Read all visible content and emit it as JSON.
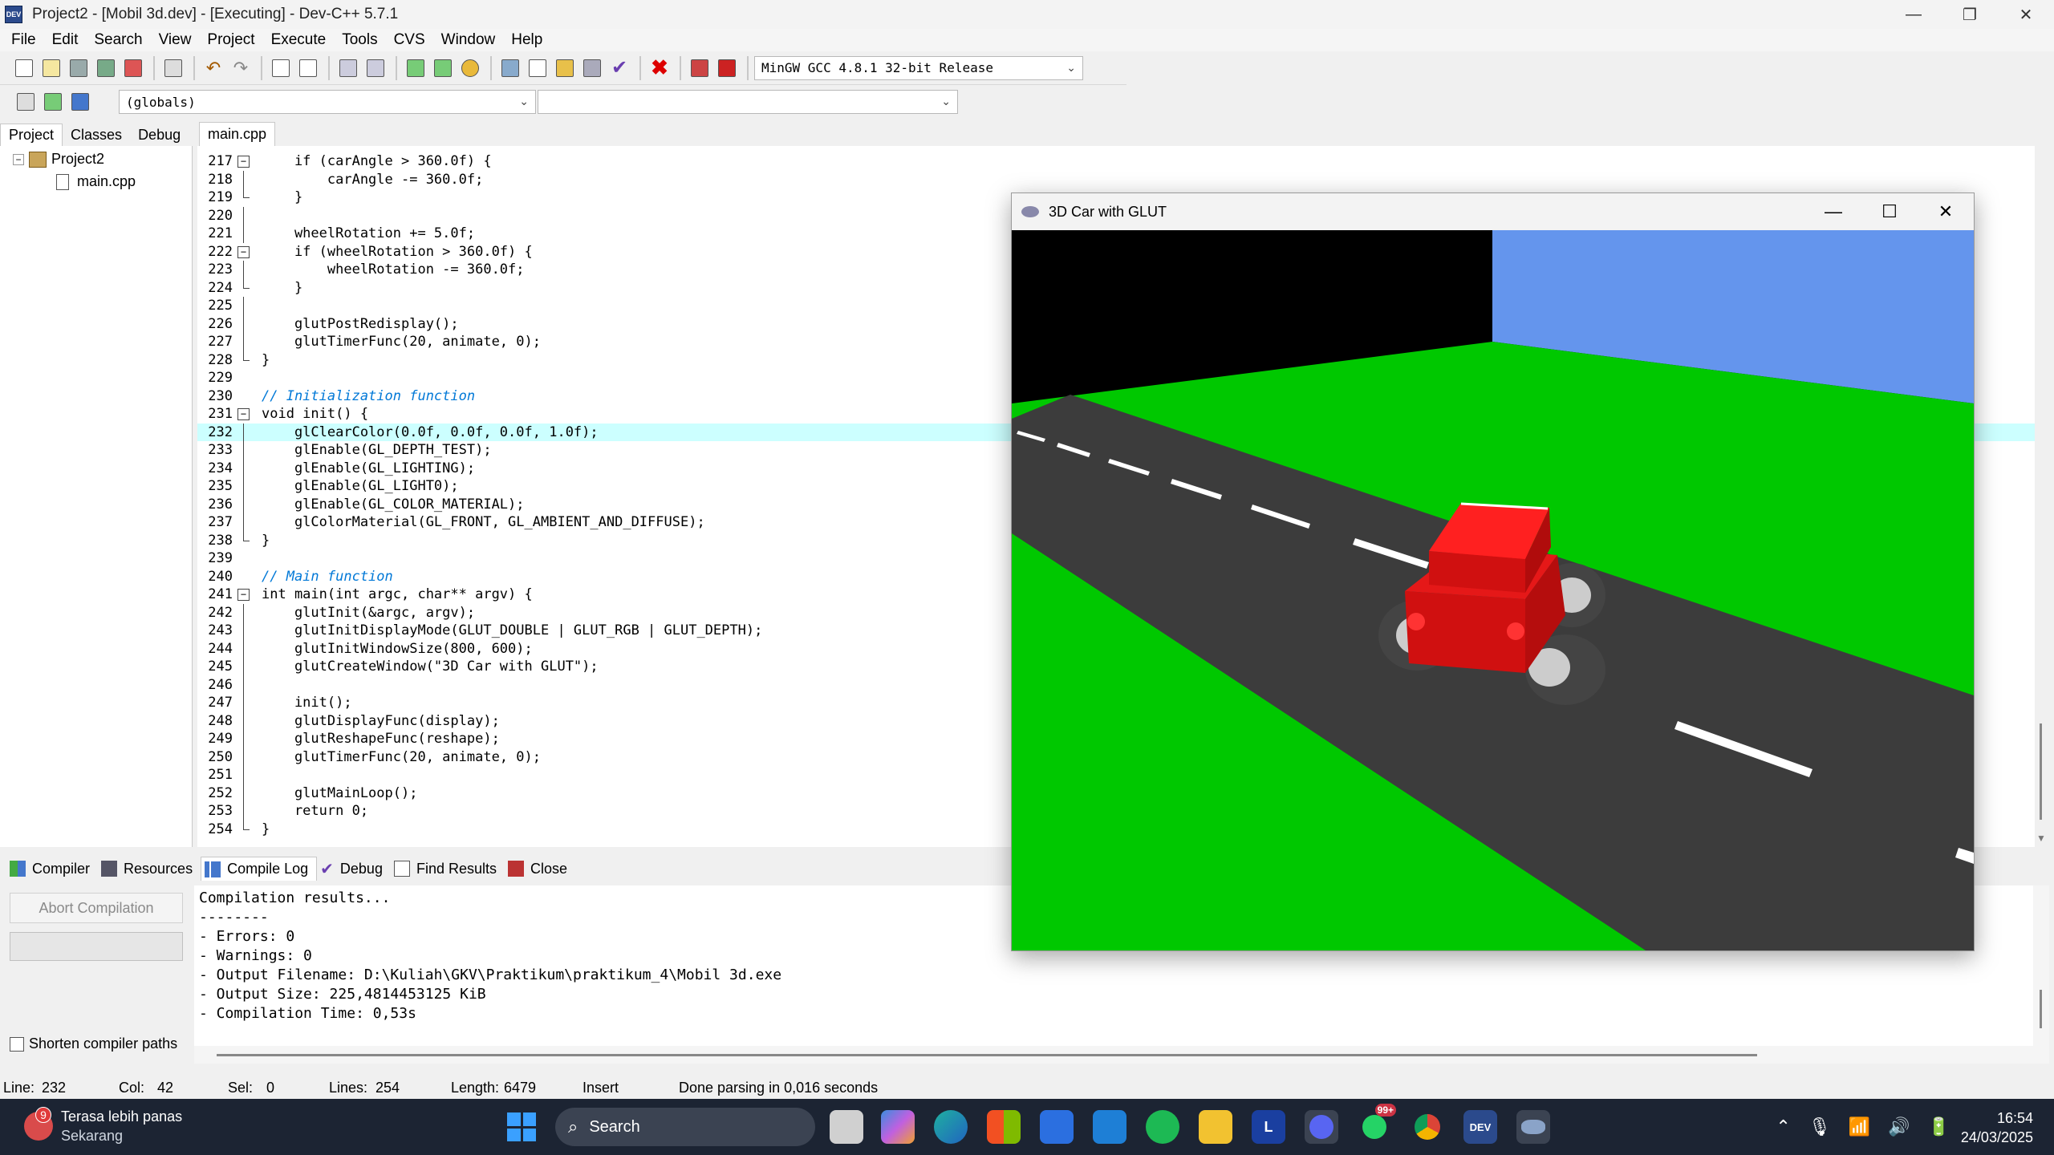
{
  "window": {
    "title": "Project2 - [Mobil 3d.dev] - [Executing] - Dev-C++ 5.7.1",
    "icon_text": "DEV"
  },
  "menu": [
    "File",
    "Edit",
    "Search",
    "View",
    "Project",
    "Execute",
    "Tools",
    "CVS",
    "Window",
    "Help"
  ],
  "toolbar": {
    "compiler_select": "MinGW GCC 4.8.1 32-bit Release",
    "scope_select": "(globals)",
    "symbol_select": ""
  },
  "left_panel": {
    "tabs": [
      "Project",
      "Classes",
      "Debug"
    ],
    "tree": {
      "project": "Project2",
      "expander": "−",
      "file": "main.cpp"
    }
  },
  "editor": {
    "tab": "main.cpp",
    "highlighted_line": 232,
    "lines": [
      {
        "n": "217",
        "code": "    if (carAngle > 360.0f) {"
      },
      {
        "n": "218",
        "code": "        carAngle -= 360.0f;"
      },
      {
        "n": "219",
        "code": "    }"
      },
      {
        "n": "220",
        "code": ""
      },
      {
        "n": "221",
        "code": "    wheelRotation += 5.0f;"
      },
      {
        "n": "222",
        "code": "    if (wheelRotation > 360.0f) {"
      },
      {
        "n": "223",
        "code": "        wheelRotation -= 360.0f;"
      },
      {
        "n": "224",
        "code": "    }"
      },
      {
        "n": "225",
        "code": ""
      },
      {
        "n": "226",
        "code": "    glutPostRedisplay();"
      },
      {
        "n": "227",
        "code": "    glutTimerFunc(20, animate, 0);"
      },
      {
        "n": "228",
        "code": "}"
      },
      {
        "n": "229",
        "code": ""
      },
      {
        "n": "230",
        "code": "// Initialization function"
      },
      {
        "n": "231",
        "code": "void init() {"
      },
      {
        "n": "232",
        "code": "    glClearColor(0.0f, 0.0f, 0.0f, 1.0f);"
      },
      {
        "n": "233",
        "code": "    glEnable(GL_DEPTH_TEST);"
      },
      {
        "n": "234",
        "code": "    glEnable(GL_LIGHTING);"
      },
      {
        "n": "235",
        "code": "    glEnable(GL_LIGHT0);"
      },
      {
        "n": "236",
        "code": "    glEnable(GL_COLOR_MATERIAL);"
      },
      {
        "n": "237",
        "code": "    glColorMaterial(GL_FRONT, GL_AMBIENT_AND_DIFFUSE);"
      },
      {
        "n": "238",
        "code": "}"
      },
      {
        "n": "239",
        "code": ""
      },
      {
        "n": "240",
        "code": "// Main function"
      },
      {
        "n": "241",
        "code": "int main(int argc, char** argv) {"
      },
      {
        "n": "242",
        "code": "    glutInit(&argc, argv);"
      },
      {
        "n": "243",
        "code": "    glutInitDisplayMode(GLUT_DOUBLE | GLUT_RGB | GLUT_DEPTH);"
      },
      {
        "n": "244",
        "code": "    glutInitWindowSize(800, 600);"
      },
      {
        "n": "245",
        "code": "    glutCreateWindow(\"3D Car with GLUT\");"
      },
      {
        "n": "246",
        "code": ""
      },
      {
        "n": "247",
        "code": "    init();"
      },
      {
        "n": "248",
        "code": "    glutDisplayFunc(display);"
      },
      {
        "n": "249",
        "code": "    glutReshapeFunc(reshape);"
      },
      {
        "n": "250",
        "code": "    glutTimerFunc(20, animate, 0);"
      },
      {
        "n": "251",
        "code": ""
      },
      {
        "n": "252",
        "code": "    glutMainLoop();"
      },
      {
        "n": "253",
        "code": "    return 0;"
      },
      {
        "n": "254",
        "code": "}"
      }
    ]
  },
  "bottom_panel": {
    "tabs": [
      "Compiler",
      "Resources",
      "Compile Log",
      "Debug",
      "Find Results",
      "Close"
    ],
    "active_tab": "Compile Log",
    "abort_button": "Abort Compilation",
    "shorten_paths": "Shorten compiler paths",
    "log": [
      "Compilation results...",
      "--------",
      "- Errors: 0",
      "- Warnings: 0",
      "- Output Filename: D:\\Kuliah\\GKV\\Praktikum\\praktikum_4\\Mobil 3d.exe",
      "- Output Size: 225,4814453125 KiB",
      "- Compilation Time: 0,53s"
    ]
  },
  "status": {
    "line_label": "Line:",
    "line": "232",
    "col_label": "Col:",
    "col": "42",
    "sel_label": "Sel:",
    "sel": "0",
    "lines_label": "Lines:",
    "lines": "254",
    "length_label": "Length:",
    "length": "6479",
    "mode": "Insert",
    "message": "Done parsing in 0,016 seconds"
  },
  "glut_window": {
    "title": "3D Car with GLUT",
    "colors": {
      "sky": "#6495ED",
      "grass": "#00C800",
      "road": "#3a3a3a",
      "car": "#E01010",
      "background": "#000000"
    }
  },
  "taskbar": {
    "weather_badge": "9",
    "weather_line1": "Terasa lebih panas",
    "weather_line2": "Sekarang",
    "search": "Search",
    "apps": [
      {
        "icon": "task-view-icon",
        "label": ""
      },
      {
        "icon": "copilot-icon",
        "label": ""
      },
      {
        "icon": "edge-icon",
        "label": ""
      },
      {
        "icon": "store-icon",
        "label": ""
      },
      {
        "icon": "word-icon",
        "label": ""
      },
      {
        "icon": "vscode-icon",
        "label": ""
      },
      {
        "icon": "spotify-icon",
        "label": ""
      },
      {
        "icon": "file-explorer-icon",
        "label": ""
      },
      {
        "icon": "line-app-icon",
        "label": "L"
      },
      {
        "icon": "discord-icon",
        "label": ""
      },
      {
        "icon": "whatsapp-icon",
        "label": "99+"
      },
      {
        "icon": "chrome-icon",
        "label": ""
      },
      {
        "icon": "devcpp-icon",
        "label": "DEV"
      },
      {
        "icon": "glut-app-icon",
        "label": ""
      }
    ],
    "time": "16:54",
    "date": "24/03/2025"
  }
}
